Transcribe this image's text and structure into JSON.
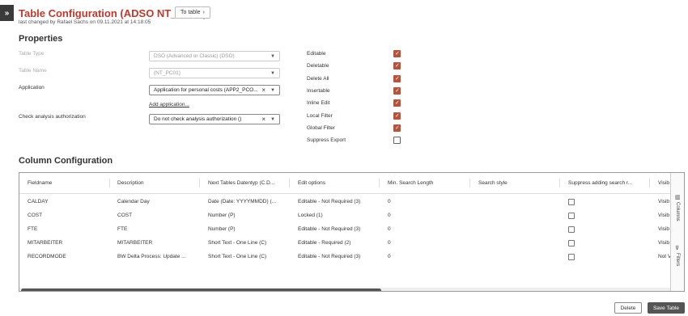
{
  "header": {
    "menu_icon": "double-chevron-right-icon",
    "title": "Table Configuration (ADSO NT_PC01)",
    "to_table_label": "To table",
    "changed_text": "last changed by Rafael Sachs on 09.11.2021 at 14:18:05"
  },
  "properties": {
    "heading": "Properties",
    "table_type": {
      "label": "Table Type",
      "value": "DSO (Advanced or Classic) (DSO)"
    },
    "table_name": {
      "label": "Table Name",
      "value": "(NT_PC01)"
    },
    "application": {
      "label": "Application",
      "value": "Application for personal costs (APP2_PCO...",
      "add_link": "Add application..."
    },
    "check_auth": {
      "label": "Check analysis authorization",
      "value": "Do not check analysis authorization ()"
    },
    "flags": [
      {
        "label": "Editable",
        "checked": true
      },
      {
        "label": "Deletable",
        "checked": true
      },
      {
        "label": "Delete All",
        "checked": true
      },
      {
        "label": "Insertable",
        "checked": true
      },
      {
        "label": "Inline Edit",
        "checked": true
      },
      {
        "label": "Local Filter",
        "checked": true
      },
      {
        "label": "Global Filter",
        "checked": true
      },
      {
        "label": "Suppress Export",
        "checked": false
      }
    ]
  },
  "columns": {
    "heading": "Column Configuration",
    "headers": [
      "Fieldname",
      "Description",
      "Next Tables Datentyp (C.D...",
      "Edit options",
      "Min. Search Length",
      "Search style",
      "Suppress adding search r...",
      "Visib"
    ],
    "rows": [
      {
        "fieldname": "CALDAY",
        "description": "Calendar Day",
        "datatype": "Date (Date: YYYYMMDD) (...",
        "edit": "Editable - Not Required (3)",
        "min_search": "0",
        "visible": "Visib"
      },
      {
        "fieldname": "COST",
        "description": "COST",
        "datatype": "Number (P)",
        "edit": "Locked (1)",
        "min_search": "0",
        "visible": "Visib"
      },
      {
        "fieldname": "FTE",
        "description": "FTE",
        "datatype": "Number (P)",
        "edit": "Editable - Not Required (3)",
        "min_search": "0",
        "visible": "Visib"
      },
      {
        "fieldname": "MITARBEITER",
        "description": "MITARBEITER",
        "datatype": "Short Text - One Line (C)",
        "edit": "Editable - Required (2)",
        "min_search": "0",
        "visible": "Visib"
      },
      {
        "fieldname": "RECORDMODE",
        "description": "BW Delta Process: Update ...",
        "datatype": "Short Text - One Line (C)",
        "edit": "Editable - Not Required (3)",
        "min_search": "0",
        "visible": "Not V"
      }
    ],
    "side_columns_label": "Columns",
    "side_filters_label": "Filters"
  },
  "footer": {
    "delete_label": "Delete",
    "save_label": "Save Table"
  }
}
